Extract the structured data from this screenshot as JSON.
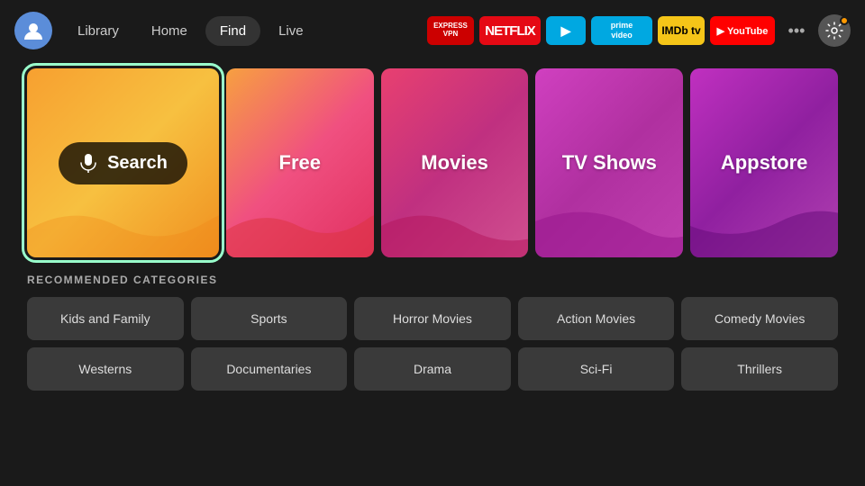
{
  "nav": {
    "links": [
      {
        "label": "Library",
        "active": false
      },
      {
        "label": "Home",
        "active": false
      },
      {
        "label": "Find",
        "active": true
      },
      {
        "label": "Live",
        "active": false
      }
    ],
    "apps": [
      {
        "name": "ExpressVPN",
        "class": "app-express",
        "label": "Express VPN"
      },
      {
        "name": "Netflix",
        "class": "app-netflix",
        "label": "NETFLIX"
      },
      {
        "name": "Freevee",
        "class": "app-freevee",
        "label": "▶"
      },
      {
        "name": "Prime Video",
        "class": "app-prime",
        "label": "prime\nvideo"
      },
      {
        "name": "IMDb TV",
        "class": "app-imdb",
        "label": "IMDb tv"
      },
      {
        "name": "YouTube",
        "class": "app-youtube",
        "label": "▶ YouTube"
      }
    ],
    "more_label": "•••",
    "settings_label": "⚙"
  },
  "tiles": [
    {
      "id": "search",
      "label": "Search",
      "type": "search"
    },
    {
      "id": "free",
      "label": "Free"
    },
    {
      "id": "movies",
      "label": "Movies"
    },
    {
      "id": "tvshows",
      "label": "TV Shows"
    },
    {
      "id": "appstore",
      "label": "Appstore"
    }
  ],
  "recommended": {
    "title": "RECOMMENDED CATEGORIES",
    "rows": [
      [
        "Kids and Family",
        "Sports",
        "Horror Movies",
        "Action Movies",
        "Comedy Movies"
      ],
      [
        "Westerns",
        "Documentaries",
        "Drama",
        "Sci-Fi",
        "Thrillers"
      ]
    ]
  }
}
